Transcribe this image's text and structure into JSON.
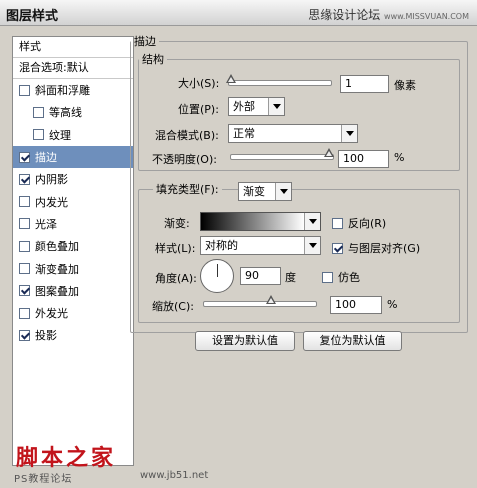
{
  "window": {
    "title": "图层样式"
  },
  "watermark": {
    "top_text": "思缘设计论坛",
    "top_small": "www.MISSVUAN.COM",
    "logo_text": "脚本之家",
    "url_text": "PS教程论坛",
    "url2_text": "www.jb51.net"
  },
  "sidebar": {
    "header": "样式",
    "blend_item": "混合选项:默认",
    "items": [
      {
        "label": "斜面和浮雕",
        "checked": false,
        "sub": false,
        "active": false
      },
      {
        "label": "等高线",
        "checked": false,
        "sub": true,
        "active": false
      },
      {
        "label": "纹理",
        "checked": false,
        "sub": true,
        "active": false
      },
      {
        "label": "描边",
        "checked": true,
        "sub": false,
        "active": true
      },
      {
        "label": "内阴影",
        "checked": true,
        "sub": false,
        "active": false
      },
      {
        "label": "内发光",
        "checked": false,
        "sub": false,
        "active": false
      },
      {
        "label": "光泽",
        "checked": false,
        "sub": false,
        "active": false
      },
      {
        "label": "颜色叠加",
        "checked": false,
        "sub": false,
        "active": false
      },
      {
        "label": "渐变叠加",
        "checked": false,
        "sub": false,
        "active": false
      },
      {
        "label": "图案叠加",
        "checked": true,
        "sub": false,
        "active": false
      },
      {
        "label": "外发光",
        "checked": false,
        "sub": false,
        "active": false
      },
      {
        "label": "投影",
        "checked": true,
        "sub": false,
        "active": false
      }
    ]
  },
  "stroke": {
    "group_title": "描边",
    "structure_title": "结构",
    "size_label": "大小(S):",
    "size_value": "1",
    "size_unit": "像素",
    "position_label": "位置(P):",
    "position_value": "外部",
    "blend_label": "混合模式(B):",
    "blend_value": "正常",
    "opacity_label": "不透明度(O):",
    "opacity_value": "100",
    "opacity_unit": "%",
    "fill_type_label": "填充类型(F):",
    "fill_type_value": "渐变",
    "gradient_label": "渐变:",
    "reverse_label": "反向(R)",
    "style_label": "样式(L):",
    "style_value": "对称的",
    "align_label": "与图层对齐(G)",
    "angle_label": "角度(A):",
    "angle_value": "90",
    "angle_unit": "度",
    "dither_label": "仿色",
    "scale_label": "缩放(C):",
    "scale_value": "100",
    "scale_unit": "%"
  },
  "buttons": {
    "make_default": "设置为默认值",
    "reset_default": "复位为默认值"
  }
}
